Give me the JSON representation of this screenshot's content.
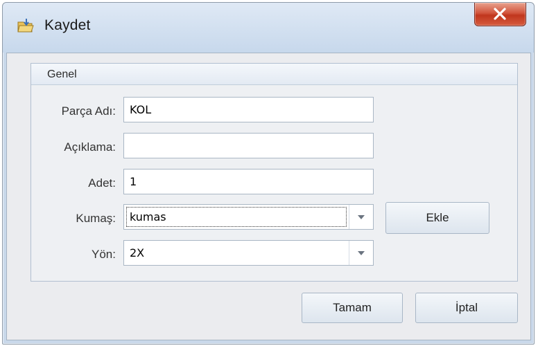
{
  "window": {
    "title": "Kaydet"
  },
  "group": {
    "caption": "Genel"
  },
  "form": {
    "parca_adi": {
      "label": "Parça Adı:",
      "value": "KOL"
    },
    "aciklama": {
      "label": "Açıklama:",
      "value": ""
    },
    "adet": {
      "label": "Adet:",
      "value": "1"
    },
    "kumas": {
      "label": "Kumaş:",
      "value": "kumas"
    },
    "yon": {
      "label": "Yön:",
      "value": "2X"
    }
  },
  "buttons": {
    "ekle": "Ekle",
    "tamam": "Tamam",
    "iptal": "İptal"
  },
  "icons": {
    "app": "save-folder-icon",
    "close": "close-icon",
    "dropdown": "chevron-down-icon"
  },
  "colors": {
    "close_button": "#c9432a",
    "client_background": "#ebecef"
  }
}
